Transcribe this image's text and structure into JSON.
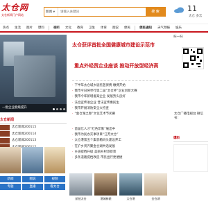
{
  "logo": {
    "main": "太仓网",
    "sub": "太仓新闻门户网站"
  },
  "search": {
    "category": "新闻",
    "placeholder": "请输入关键词",
    "button": "搜 索"
  },
  "weather": {
    "temp": "11",
    "text": "太仓 多云"
  },
  "nav": [
    "热点",
    "生活",
    "图片",
    "爆料",
    "视听",
    "文化",
    "教育",
    "卫生",
    "体育",
    "图说",
    "便民",
    "便民通知",
    "天气预报",
    "娱乐"
  ],
  "slideshow": {
    "caption": "一批企业能级提升"
  },
  "headlines": [
    "太仓获评首批全国健康城市建设示范市",
    "重点外经贸企业座谈 推动开放型经济高"
  ],
  "news": [
    "下半年太仓城乡居民医保费 缴费开始",
    "我市今日将举行第二届“太仓杯”企业创新大赛",
    "我市今年新增备案企业 发展势头良好",
    "法治宣传进企业 普法宣传惠民生",
    "我市开展消防安全大检查",
    "“金仓湖之春”文化艺术节闭幕"
  ],
  "news2": [
    "首届亿人才“红色印象”展出中",
    "我市为民办实事项目“江苏太仓”",
    "太仓港第五个集装箱码头建设开工",
    "在沪乡贤齐聚金仓湖共话发展",
    "乡道提档升级 美丽乡村添新景",
    "多条道路提档改造 市民出行更便捷"
  ],
  "left_list": {
    "header": "太仓新闻",
    "items": [
      "太仓新闻200115",
      "太仓新闻200114",
      "太仓新闻200113",
      "太仓新闻200112"
    ]
  },
  "left_buttons": [
    "新闻",
    "图说",
    "视频",
    "专题",
    "直播",
    "看太仓"
  ],
  "photos": [
    "航拍太仓",
    "港城新貌",
    "太仓港",
    "金仓湖"
  ],
  "right": {
    "qr_title": "扫一扫",
    "qr_caption": "太仓广播电视台 微信号：",
    "section": "爆料"
  }
}
